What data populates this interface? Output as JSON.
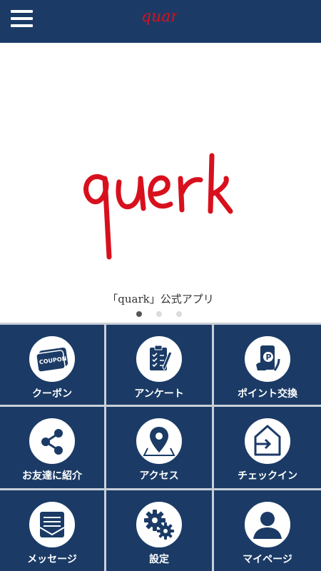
{
  "header": {
    "logo_text": "quark"
  },
  "hero": {
    "logo_text": "quark",
    "caption": "「quark」公式アプリ",
    "slide_count": 3,
    "active_slide": 1
  },
  "menu": {
    "tiles": [
      {
        "label": "クーポン",
        "icon": "coupon-icon",
        "coupon_text": "COUPON"
      },
      {
        "label": "アンケート",
        "icon": "survey-icon"
      },
      {
        "label": "ポイント交換",
        "icon": "point-exchange-icon",
        "point_text": "P"
      },
      {
        "label": "お友達に紹介",
        "icon": "share-icon"
      },
      {
        "label": "アクセス",
        "icon": "map-pin-icon"
      },
      {
        "label": "チェックイン",
        "icon": "checkin-icon"
      },
      {
        "label": "メッセージ",
        "icon": "message-icon"
      },
      {
        "label": "設定",
        "icon": "gear-icon"
      },
      {
        "label": "マイページ",
        "icon": "user-icon"
      }
    ]
  },
  "colors": {
    "navy": "#1b3b66",
    "brand_red": "#d8101d",
    "grid_line": "#c9cfd8"
  }
}
